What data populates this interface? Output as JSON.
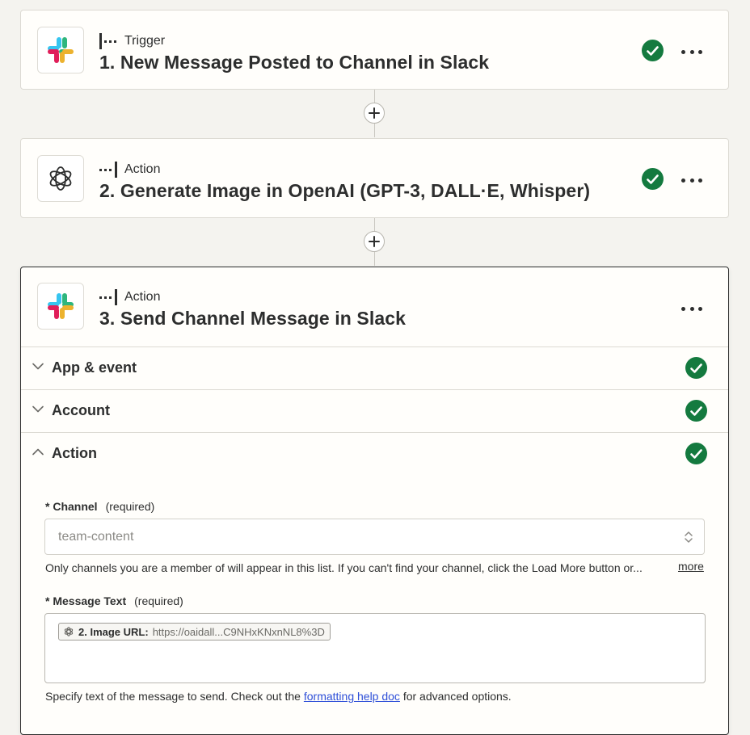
{
  "steps": [
    {
      "type": "Trigger",
      "title": "1. New Message Posted to Channel in Slack",
      "app_icon": "slack-icon",
      "status": "complete"
    },
    {
      "type": "Action",
      "title": "2. Generate Image in OpenAI (GPT-3, DALL·E, Whisper)",
      "app_icon": "openai-icon",
      "status": "complete"
    },
    {
      "type": "Action",
      "title": "3. Send Channel Message in Slack",
      "app_icon": "slack-icon"
    }
  ],
  "sections": [
    {
      "label": "App & event",
      "state": "collapsed",
      "status": "complete"
    },
    {
      "label": "Account",
      "state": "collapsed",
      "status": "complete"
    },
    {
      "label": "Action",
      "state": "expanded",
      "status": "complete"
    }
  ],
  "form": {
    "channel": {
      "label": "* Channel",
      "required_note": "(required)",
      "value": "team-content",
      "help": "Only channels you are a member of will appear in this list. If you can't find your channel, click the Load More button or...",
      "more": "more"
    },
    "message_text": {
      "label": "* Message Text",
      "required_note": "(required)",
      "pill": {
        "label": "2. Image URL:",
        "value": "https://oaidall...C9NHxKNxnNL8%3D",
        "icon": "openai-icon"
      },
      "help_prefix": "Specify text of the message to send. Check out the ",
      "help_link": "formatting help doc",
      "help_suffix": " for advanced options."
    }
  },
  "colors": {
    "background": "#f4f3ef",
    "card": "#fffefb",
    "success": "#147a3f",
    "link": "#2e4fd8",
    "text": "#2d2e2e"
  }
}
